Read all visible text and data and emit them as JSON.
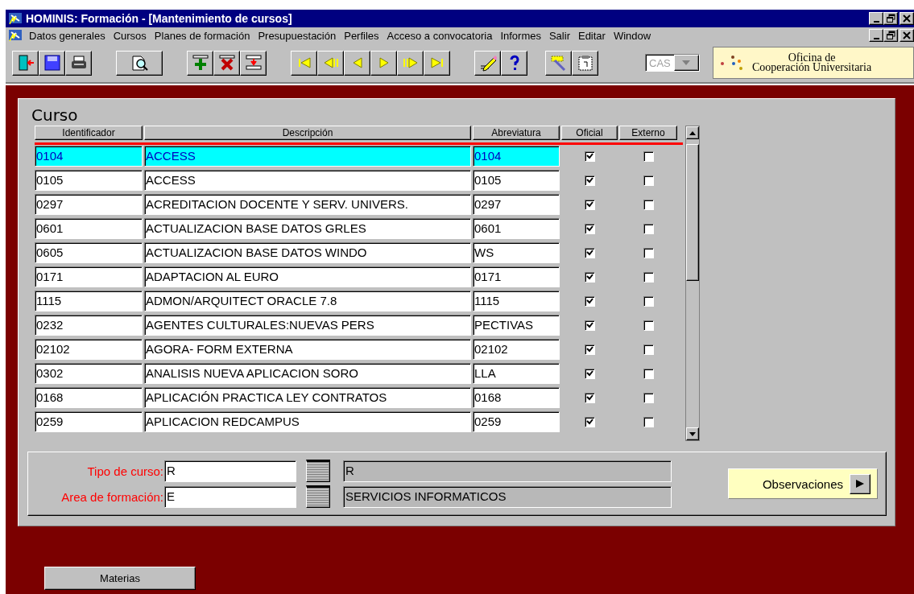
{
  "window": {
    "title": "HOMINIS: Formación - [Mantenimiento de cursos]"
  },
  "menu": [
    "Datos generales",
    "Cursos",
    "Planes de formación",
    "Presupuestación",
    "Perfiles",
    "Acceso a convocatoria",
    "Informes",
    "Salir",
    "Editar",
    "Window"
  ],
  "language_combo": {
    "value": "CAS"
  },
  "logo": {
    "line_1": "Oficina de",
    "line_2": "Cooperación Universitaria"
  },
  "section_title": "Curso",
  "table": {
    "columns": [
      "Identificador",
      "Descripción",
      "Abreviatura",
      "Oficial",
      "Externo"
    ],
    "rows": [
      {
        "id": "0104",
        "description": "ACCESS",
        "abbreviation": "0104",
        "oficial": true,
        "externo": false,
        "selected": true
      },
      {
        "id": "0105",
        "description": "ACCESS",
        "abbreviation": "0105",
        "oficial": true,
        "externo": false,
        "selected": false
      },
      {
        "id": "0297",
        "description": "ACREDITACION DOCENTE Y SERV. UNIVERS.",
        "abbreviation": "0297",
        "oficial": true,
        "externo": false,
        "selected": false
      },
      {
        "id": "0601",
        "description": "ACTUALIZACION BASE DATOS GRLES",
        "abbreviation": "0601",
        "oficial": true,
        "externo": false,
        "selected": false
      },
      {
        "id": "0605",
        "description": "ACTUALIZACION BASE DATOS WINDO",
        "abbreviation": "WS",
        "oficial": true,
        "externo": false,
        "selected": false
      },
      {
        "id": "0171",
        "description": "ADAPTACION AL EURO",
        "abbreviation": "0171",
        "oficial": true,
        "externo": false,
        "selected": false
      },
      {
        "id": "1115",
        "description": "ADMON/ARQUITECT ORACLE 7.8",
        "abbreviation": "1115",
        "oficial": true,
        "externo": false,
        "selected": false
      },
      {
        "id": "0232",
        "description": "AGENTES CULTURALES:NUEVAS PERS",
        "abbreviation": "PECTIVAS",
        "oficial": true,
        "externo": false,
        "selected": false
      },
      {
        "id": "02102",
        "description": "AGORA- FORM EXTERNA",
        "abbreviation": "02102",
        "oficial": true,
        "externo": false,
        "selected": false
      },
      {
        "id": "0302",
        "description": "ANALISIS NUEVA APLICACION SORO",
        "abbreviation": "LLA",
        "oficial": true,
        "externo": false,
        "selected": false
      },
      {
        "id": "0168",
        "description": "APLICACIÓN PRACTICA LEY CONTRATOS",
        "abbreviation": "0168",
        "oficial": true,
        "externo": false,
        "selected": false
      },
      {
        "id": "0259",
        "description": "APLICACION REDCAMPUS",
        "abbreviation": "0259",
        "oficial": true,
        "externo": false,
        "selected": false
      }
    ]
  },
  "detail": {
    "fields": [
      {
        "label": "Tipo de curso:",
        "value": "R",
        "description": "R"
      },
      {
        "label": "Area de formación:",
        "value": "E",
        "description": "SERVICIOS INFORMATICOS"
      }
    ]
  },
  "observaciones_button": "Observaciones",
  "materias_button": "Materias"
}
